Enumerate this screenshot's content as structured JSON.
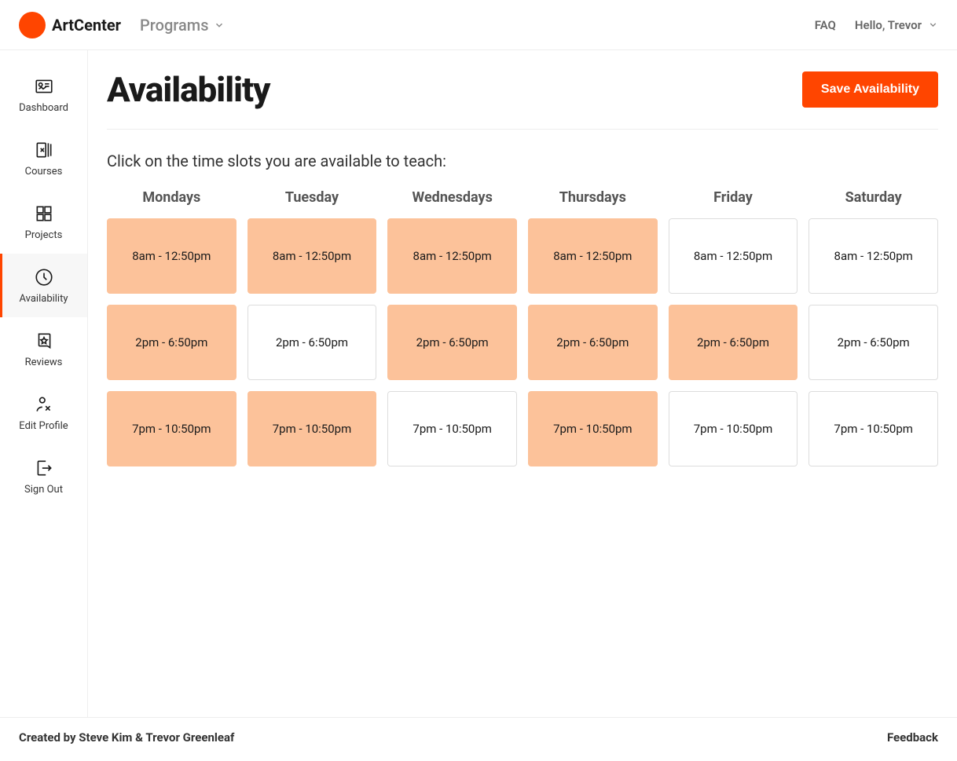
{
  "header": {
    "brand": "ArtCenter",
    "programs_label": "Programs",
    "faq_label": "FAQ",
    "user_greeting": "Hello, Trevor"
  },
  "sidebar": {
    "items": [
      {
        "key": "dashboard",
        "label": "Dashboard"
      },
      {
        "key": "courses",
        "label": "Courses"
      },
      {
        "key": "projects",
        "label": "Projects"
      },
      {
        "key": "availability",
        "label": "Availability"
      },
      {
        "key": "reviews",
        "label": "Reviews"
      },
      {
        "key": "edit-profile",
        "label": "Edit Profile"
      },
      {
        "key": "sign-out",
        "label": "Sign Out"
      }
    ],
    "active_key": "availability"
  },
  "page": {
    "title": "Availability",
    "save_button": "Save Availability",
    "instruction": "Click on the time slots you are available to teach:"
  },
  "schedule": {
    "days": [
      "Mondays",
      "Tuesday",
      "Wednesdays",
      "Thursdays",
      "Friday",
      "Saturday"
    ],
    "slots": [
      "8am - 12:50pm",
      "2pm - 6:50pm",
      "7pm - 10:50pm"
    ],
    "selected": [
      [
        true,
        true,
        true,
        true,
        false,
        false
      ],
      [
        true,
        false,
        true,
        true,
        true,
        false
      ],
      [
        true,
        true,
        false,
        true,
        false,
        false
      ]
    ]
  },
  "footer": {
    "credit": "Created by Steve Kim & Trevor Greenleaf",
    "feedback_label": "Feedback"
  }
}
